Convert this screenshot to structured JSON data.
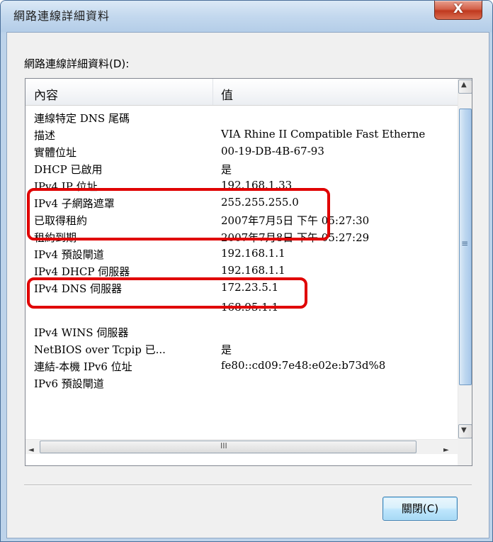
{
  "window": {
    "title": "網路連線詳細資料",
    "close_glyph": "X"
  },
  "group_label": "網路連線詳細資料(D):",
  "columns": {
    "property": "內容",
    "value": "值"
  },
  "rows": [
    {
      "property": "連線特定 DNS 尾碼",
      "value": ""
    },
    {
      "property": "描述",
      "value": "VIA Rhine II Compatible Fast Etherne"
    },
    {
      "property": "實體位址",
      "value": "00-19-DB-4B-67-93"
    },
    {
      "property": "DHCP 已啟用",
      "value": "是"
    },
    {
      "property": "IPv4 IP 位址",
      "value": "192.168.1.33"
    },
    {
      "property": "IPv4 子網路遮罩",
      "value": "255.255.255.0"
    },
    {
      "property": "已取得租約",
      "value": "2007年7月5日 下午 05:27:30"
    },
    {
      "property": "租約到期",
      "value": "2007年7月8日 下午 05:27:29"
    },
    {
      "property": "IPv4 預設閘道",
      "value": "192.168.1.1"
    },
    {
      "property": "IPv4 DHCP 伺服器",
      "value": "192.168.1.1"
    },
    {
      "property": "IPv4 DNS 伺服器",
      "value": "172.23.5.1"
    },
    {
      "property": "",
      "value": "168.95.1.1"
    },
    {
      "property": "IPv4 WINS 伺服器",
      "value": ""
    },
    {
      "property": "NetBIOS over Tcpip 已...",
      "value": "是"
    },
    {
      "property": "連結-本機 IPv6 位址",
      "value": "fe80::cd09:7e48:e02e:b73d%8"
    },
    {
      "property": "IPv6 預設閘道",
      "value": ""
    }
  ],
  "scroll": {
    "up": "▲",
    "down": "▼",
    "left": "◄",
    "right": "►",
    "grip": "≡",
    "hgrip": "III"
  },
  "close_button": "關閉(C)",
  "colors": {
    "highlight": "#e00000",
    "close_accent": "#c0391f"
  }
}
